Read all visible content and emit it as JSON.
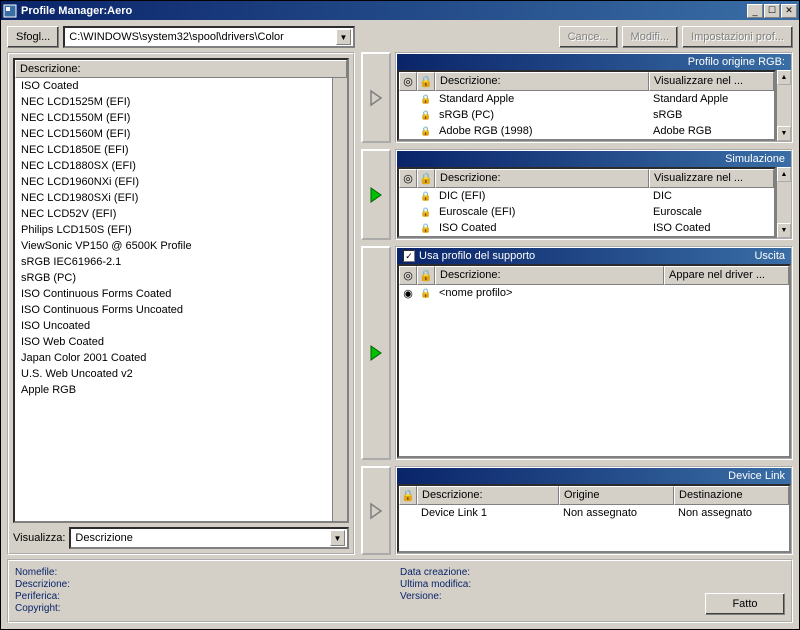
{
  "window": {
    "title": "Profile Manager:Aero"
  },
  "toolbar": {
    "browse": "Sfogl...",
    "path": "C:\\WINDOWS\\system32\\spool\\drivers\\Color",
    "cancel": "Cance...",
    "modify": "Modifi...",
    "settings": "Impostazioni prof..."
  },
  "left": {
    "header": "Descrizione:",
    "items": [
      "ISO Coated",
      "NEC LCD1525M (EFI)",
      "NEC LCD1550M (EFI)",
      "NEC LCD1560M (EFI)",
      "NEC LCD1850E (EFI)",
      "NEC LCD1880SX (EFI)",
      "NEC LCD1960NXi (EFI)",
      "NEC LCD1980SXi (EFI)",
      "NEC LCD52V (EFI)",
      "Philips LCD150S (EFI)",
      "ViewSonic VP150 @ 6500K Profile",
      "sRGB IEC61966-2.1",
      "sRGB (PC)",
      "ISO Continuous Forms Coated",
      "ISO Continuous Forms Uncoated",
      "ISO Uncoated",
      "ISO Web Coated",
      "Japan Color 2001 Coated",
      "U.S. Web Uncoated v2",
      "Apple RGB"
    ],
    "visualize_label": "Visualizza:",
    "visualize_value": "Descrizione"
  },
  "panels": {
    "rgb": {
      "title": "Profilo origine RGB:",
      "cols": {
        "desc": "Descrizione:",
        "vis": "Visualizzare nel ..."
      },
      "rows": [
        {
          "desc": "Standard Apple",
          "vis": "Standard Apple"
        },
        {
          "desc": "sRGB (PC)",
          "vis": "sRGB"
        },
        {
          "desc": "Adobe RGB (1998)",
          "vis": "Adobe RGB"
        }
      ]
    },
    "sim": {
      "title": "Simulazione",
      "cols": {
        "desc": "Descrizione:",
        "vis": "Visualizzare nel ..."
      },
      "rows": [
        {
          "desc": "DIC (EFI)",
          "vis": "DIC"
        },
        {
          "desc": "Euroscale (EFI)",
          "vis": "Euroscale"
        },
        {
          "desc": "ISO Coated",
          "vis": "ISO Coated"
        }
      ]
    },
    "output": {
      "checkbox_label": "Usa profilo del supporto",
      "title": "Uscita",
      "cols": {
        "desc": "Descrizione:",
        "vis": "Appare nel driver ..."
      },
      "rows": [
        {
          "desc": "<nome profilo>",
          "vis": ""
        }
      ]
    },
    "devicelink": {
      "title": "Device Link",
      "cols": {
        "desc": "Descrizione:",
        "orig": "Origine",
        "dest": "Destinazione"
      },
      "rows": [
        {
          "desc": "Device Link 1",
          "orig": "Non assegnato",
          "dest": "Non assegnato"
        }
      ]
    }
  },
  "footer": {
    "nomefile": "Nomefile:",
    "descrizione": "Descrizione:",
    "periferica": "Periferica:",
    "copyright": "Copyright:",
    "data_creazione": "Data creazione:",
    "ultima_modifica": "Ultima modifica:",
    "versione": "Versione:",
    "done": "Fatto"
  }
}
